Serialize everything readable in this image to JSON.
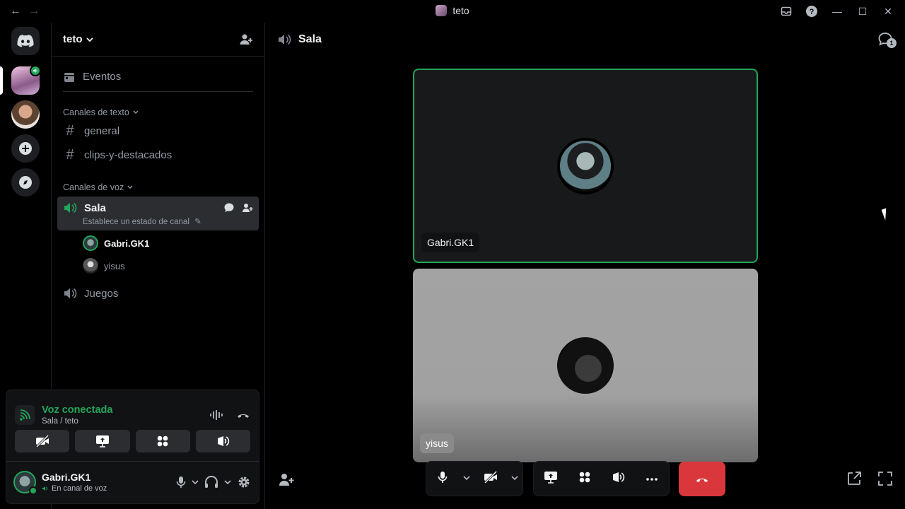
{
  "window": {
    "title": "teto",
    "back": "←",
    "forward": "→",
    "inbox_icon": "inbox-icon",
    "help": "?",
    "minimize": "—",
    "maximize": "☐",
    "close": "✕"
  },
  "rail": {
    "home_icon": "discord-logo-icon",
    "add": "+",
    "explore": "◎",
    "speaker_badge": "🔊"
  },
  "guild": {
    "name": "teto",
    "chevron": "⌄",
    "invite_icon": "👤+"
  },
  "sidebar": {
    "events": "Eventos",
    "text_category": "Canales de texto",
    "text_channels": [
      "general",
      "clips-y-destacados"
    ],
    "voice_category": "Canales de voz",
    "active_channel": "Sala",
    "active_status": "Establece un estado de canal",
    "members": [
      "Gabri.GK1",
      "yisus"
    ],
    "other_voice": "Juegos"
  },
  "voice": {
    "title": "Voz conectada",
    "subtitle": "Sala / teto"
  },
  "user": {
    "name": "Gabri.GK1",
    "status": "En canal de voz"
  },
  "main": {
    "channel_title": "Sala",
    "threads_count": "1",
    "tiles": [
      {
        "label": "Gabri.GK1"
      },
      {
        "label": "yisus"
      }
    ]
  },
  "colors": {
    "accent_green": "#23a55a",
    "danger_red": "#da373c",
    "bg": "#000000",
    "panel": "#111214"
  }
}
